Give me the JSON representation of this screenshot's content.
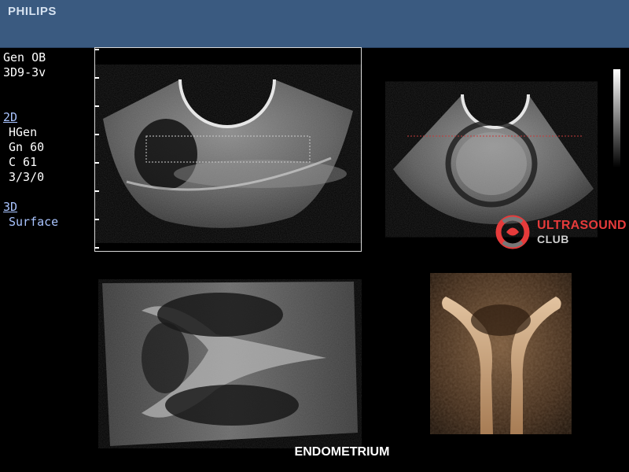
{
  "header": {
    "brand": "PHILIPS"
  },
  "params": {
    "preset": "Gen OB",
    "probe": "3D9-3v",
    "mode_2d": "2D",
    "harmonic": "HGen",
    "gain": "Gn 60",
    "compression": "C 61",
    "persist": "3/3/0",
    "mode_3d": "3D",
    "render": "Surface"
  },
  "logo": {
    "line1": "ULTRASOUND",
    "line2": "CLUB"
  },
  "caption": "ENDOMETRIUM",
  "colors": {
    "header_bg": "#3a5a80",
    "accent_text": "#a9c4ff",
    "logo_red": "#e63b3b",
    "render_tone": "#c79a6b"
  },
  "icons": {
    "logo_mark": "ultrasound-club-logo-icon"
  }
}
